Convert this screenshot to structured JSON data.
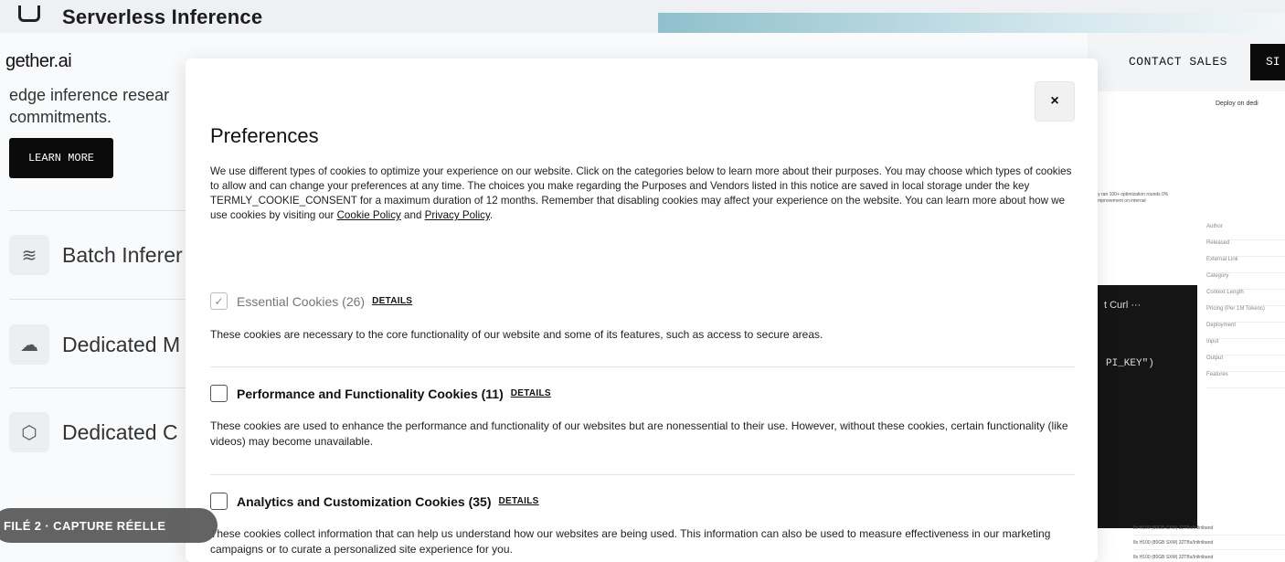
{
  "background": {
    "top_title": "Serverless Inference",
    "brand": "gether.ai",
    "hero_text_line1": "edge inference resear",
    "hero_text_line2": "commitments.",
    "learn_more": "LEARN MORE",
    "products": [
      {
        "label": "Batch Inferer",
        "icon": "layers-icon"
      },
      {
        "label": "Dedicated M",
        "icon": "cloud-network-icon"
      },
      {
        "label": "Dedicated C",
        "icon": "cube-icon"
      }
    ],
    "contact_sales": "CONTACT SALES",
    "signup_partial": "SI",
    "panel": {
      "deploy": "Deploy on dedi",
      "note": "ly ran 100+ optimization rounds 0% improvement on internal",
      "meta_rows": [
        "Author",
        "Released",
        "External Link",
        "Category",
        "Context Length",
        "Pricing (Per 1M Tokens)",
        "Deployment",
        "Input",
        "Output",
        "Features"
      ],
      "code_tabs": "t   Curl   ···",
      "code_line": "PI_KEY\")",
      "hw_rows": [
        "8x H100 (80GB SXM) 32TBs/Infiniband",
        "8x H100 (80GB SXM) 32TBs/Infiniband",
        "8x H100 (80GB SXM) 32TBs/Infiniband"
      ]
    }
  },
  "modal": {
    "close_label": "×",
    "title": "Preferences",
    "intro": "We use different types of cookies to optimize your experience on our website. Click on the categories below to learn more about their purposes. You may choose which types of cookies to allow and can change your preferences at any time. The choices you make regarding the Purposes and Vendors listed in this notice are saved in local storage under the key TERMLY_COOKIE_CONSENT for a maximum duration of 12 months. Remember that disabling cookies may affect your experience on the website. You can learn more about how we use cookies by visiting our",
    "cookie_policy_link": "Cookie Policy",
    "and_text": "and",
    "privacy_policy_link": "Privacy Policy",
    "period": ".",
    "categories": [
      {
        "name": "Essential Cookies (26)",
        "details": "DETAILS",
        "checked": true,
        "disabled": true,
        "description": "These cookies are necessary to the core functionality of our website and some of its features, such as access to secure areas."
      },
      {
        "name": "Performance and Functionality Cookies (11)",
        "details": "DETAILS",
        "checked": false,
        "disabled": false,
        "description": "These cookies are used to enhance the performance and functionality of our websites but are nonessential to their use. However, without these cookies, certain functionality (like videos) may become unavailable."
      },
      {
        "name": "Analytics and Customization Cookies (35)",
        "details": "DETAILS",
        "checked": false,
        "disabled": false,
        "description": "These cookies collect information that can help us understand how our websites are being used. This information can also be used to measure effectiveness in our marketing campaigns or to curate a personalized site experience for you."
      }
    ]
  },
  "badge": "FILÉ 2 · CAPTURE RÉELLE",
  "check_glyph": "✓"
}
